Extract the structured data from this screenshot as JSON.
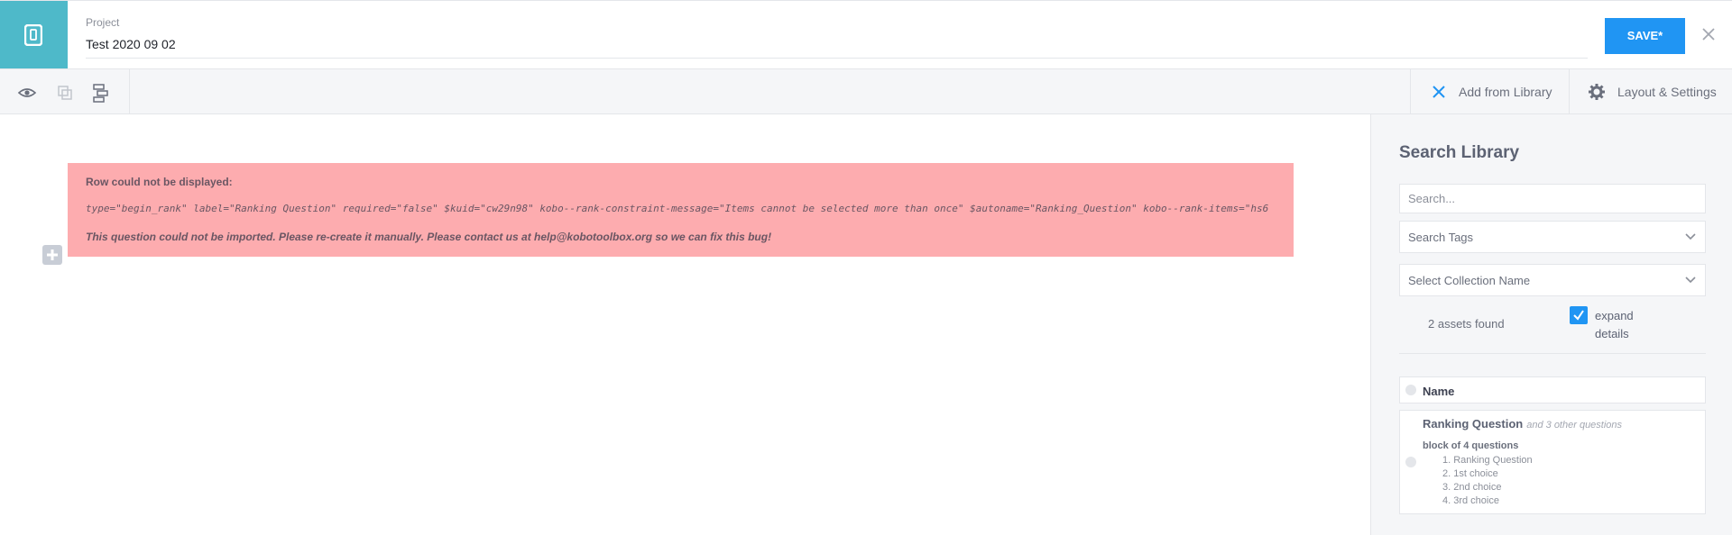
{
  "header": {
    "project_label": "Project",
    "project_name": "Test 2020 09 02",
    "save_label": "SAVE*"
  },
  "toolbar": {
    "icons": [
      "eye-icon",
      "copy-icon",
      "group-icon"
    ],
    "add_from_library": "Add from Library",
    "layout_settings": "Layout & Settings"
  },
  "error_row": {
    "title": "Row could not be displayed:",
    "code": "type=\"begin_rank\" label=\"Ranking Question\" required=\"false\" $kuid=\"cw29n98\" kobo--rank-constraint-message=\"Items cannot be selected more than once\" $autoname=\"Ranking_Question\" kobo--rank-items=\"hs6",
    "message": "This question could not be imported. Please re-create it manually. Please contact us at help@kobotoolbox.org so we can fix this bug!"
  },
  "library": {
    "title": "Search Library",
    "search_placeholder": "Search...",
    "tags_label": "Search Tags",
    "collection_label": "Select Collection Name",
    "assets_found": "2 assets found",
    "expand_label": "expand details",
    "expand_checked": true,
    "column_header": "Name",
    "assets": [
      {
        "name": "Ranking Question",
        "extra": "and 3 other questions",
        "block": "block of 4 questions",
        "questions": [
          "1. Ranking Question",
          "2. 1st choice",
          "3. 2nd choice",
          "4. 3rd choice"
        ]
      }
    ]
  },
  "colors": {
    "accent": "#2095f3",
    "logo_bg": "#4eb9c9",
    "error_bg": "#fdacaf",
    "panel_bg": "#f5f6f8"
  }
}
